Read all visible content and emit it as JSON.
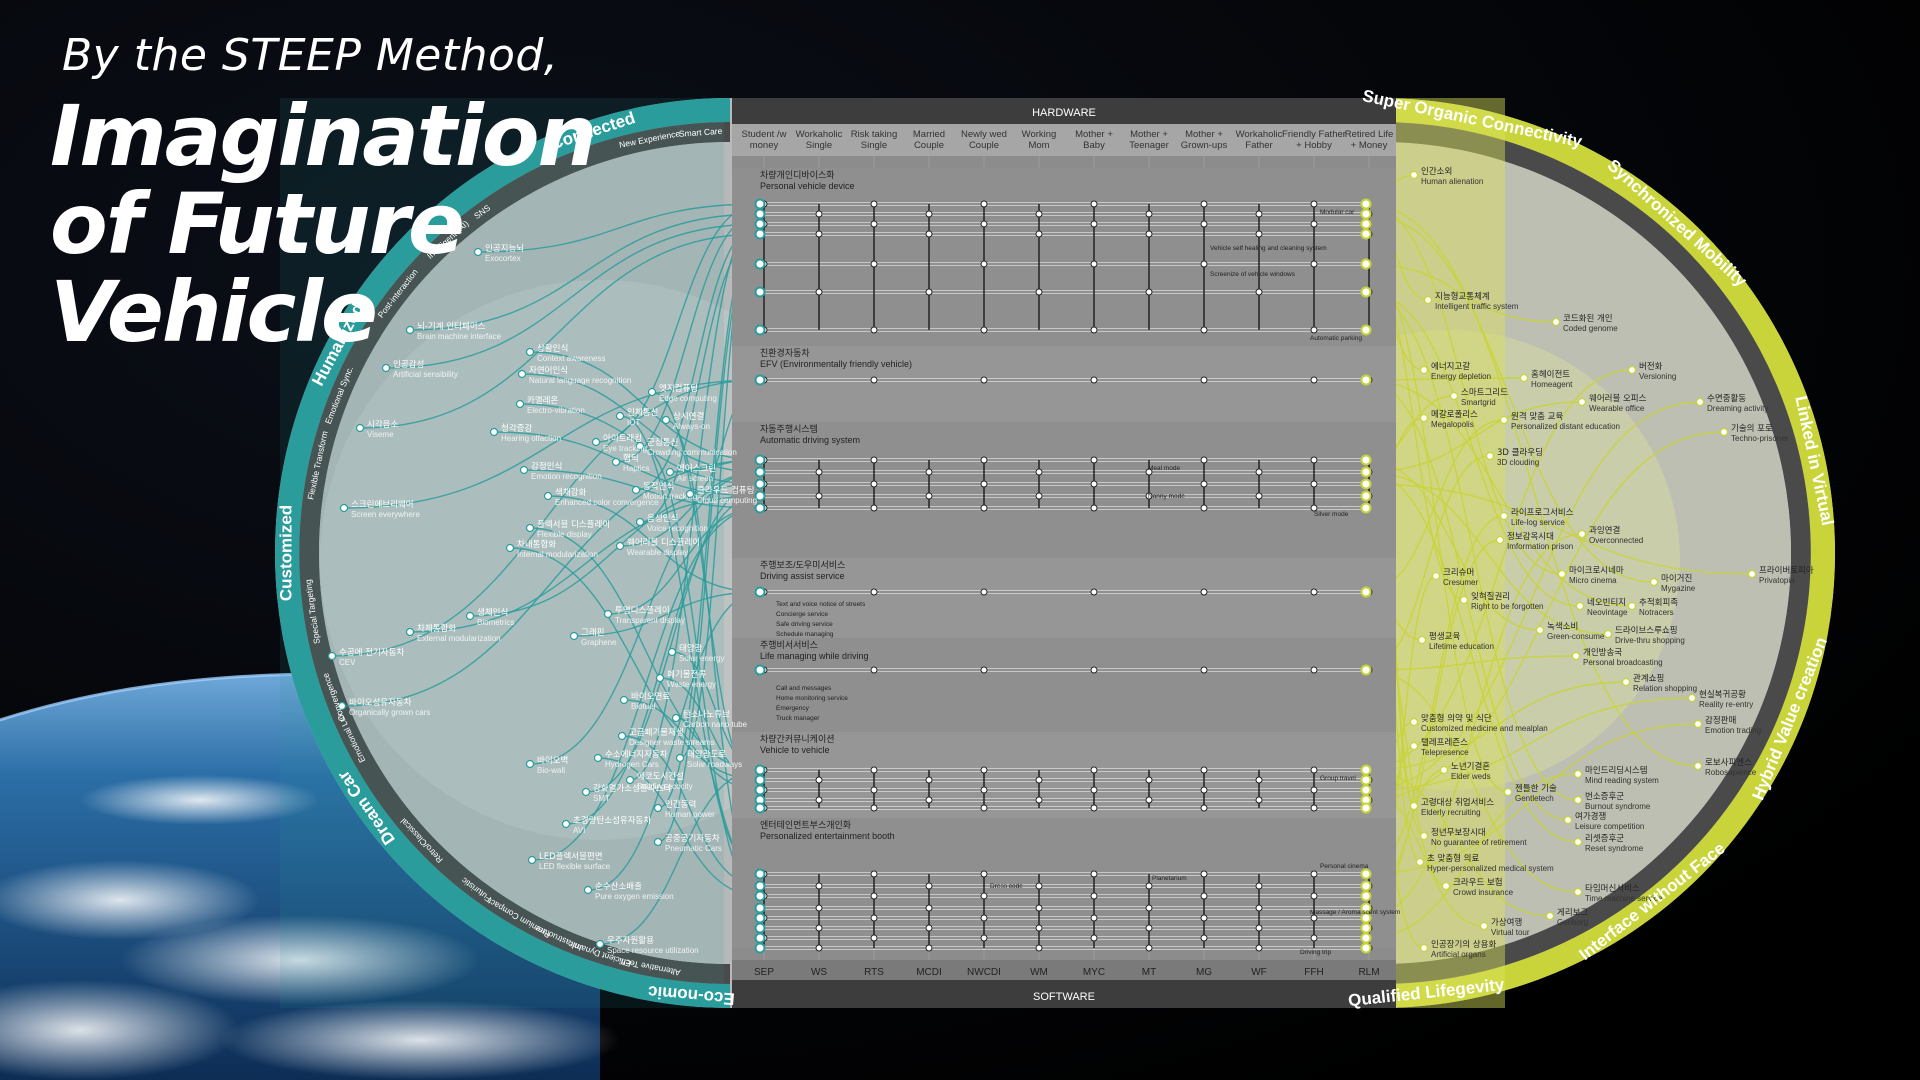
{
  "header": {
    "subtitle": "By the STEEP Method,",
    "title": "Imagination of Future Vehicle"
  },
  "colors": {
    "teal": "#2b9c9c",
    "lime": "#c9d43a",
    "panel": "#8c8c8c",
    "dark": "#3d3d3d"
  },
  "panel": {
    "top_label": "HARDWARE",
    "bottom_label": "SOFTWARE",
    "columns": [
      "Student /w money",
      "Workaholic Single",
      "Risk taking Single",
      "Married Couple",
      "Newly wed Couple",
      "Working Mom",
      "Mother + Baby",
      "Mother + Teenager",
      "Mother + Grown-ups",
      "Workaholic Father",
      "Friendly Father + Hobby",
      "Retired Life + Money"
    ],
    "column_codes": [
      "SEP",
      "WS",
      "RTS",
      "MCDI",
      "NWCDI",
      "WM",
      "MYC",
      "MT",
      "MG",
      "WF",
      "FFH",
      "RLM"
    ],
    "sections": [
      {
        "kr": "차량개인디바이스화",
        "en": "Personal vehicle device"
      },
      {
        "kr": "친환경자동차",
        "en": "EFV (Environmentally friendly vehicle)"
      },
      {
        "kr": "자동주행시스템",
        "en": "Automatic driving system"
      },
      {
        "kr": "주행보조/도우미서비스",
        "en": "Driving assist service"
      },
      {
        "kr": "주행비서서비스",
        "en": "Life managing while driving"
      },
      {
        "kr": "차량간커뮤니케이션",
        "en": "Vehicle to vehicle"
      },
      {
        "kr": "엔터테인먼트부스개인화",
        "en": "Personalized entertainment booth"
      }
    ],
    "notes": [
      "Modular car",
      "Vehicle self healing and cleaning system",
      "Screenize of vehicle windows",
      "Automatic parking",
      "Meal mode",
      "Nanny mode",
      "Silver mode",
      "Text and voice notice of streets",
      "Concierge service",
      "Safe driving service",
      "Schedule managing",
      "Call and messages",
      "Home monitoring service",
      "Emergency",
      "Truck manager",
      "Group travel",
      "Personal cinema",
      "Dress code",
      "Planetarium",
      "Massage / Aroma scent system",
      "Driving trip"
    ]
  },
  "left_ring": {
    "labels": [
      "Connected",
      "New Experience",
      "Smart Care",
      "SNS",
      "Intelligent (AI)",
      "Post-interaction",
      "Humanized",
      "Emotional Sync.",
      "Flexible Transform",
      "Customized",
      "Special Targeting",
      "Convergence",
      "Emotional Lux",
      "Dream Car",
      "Retro/Classical",
      "Futuristic",
      "Premium Compact",
      "Infrastructure",
      "Efficient Dynamic",
      "Alternative Tech.",
      "Eco-nomic"
    ]
  },
  "right_ring": {
    "labels": [
      "Super Organic Connectivity",
      "Synchronized Mobility",
      "Linked in Virtual",
      "Hybrid Value creation",
      "Interface without Face",
      "Qualified Lifegevity"
    ]
  },
  "left_nodes": [
    {
      "kr": "인공지능뇌",
      "en": "Exocortex"
    },
    {
      "kr": "뇌-기계 인터페이스",
      "en": "Brain machine interface"
    },
    {
      "kr": "인공감성",
      "en": "Artificial sensibility"
    },
    {
      "kr": "시각음소",
      "en": "Viseme"
    },
    {
      "kr": "스크린에브리웨어",
      "en": "Screen everywhere"
    },
    {
      "kr": "상황인식",
      "en": "Context awareness"
    },
    {
      "kr": "자연어인식",
      "en": "Natural language recognition"
    },
    {
      "kr": "카멜레온",
      "en": "Electro-vibration"
    },
    {
      "kr": "청각증강",
      "en": "Hearing olfaction"
    },
    {
      "kr": "감정인식",
      "en": "Emotion recognition"
    },
    {
      "kr": "색채강화",
      "en": "Enhanced color convergence"
    },
    {
      "kr": "플렉서블 디스플레이",
      "en": "Flexible display"
    },
    {
      "kr": "차내통합화",
      "en": "Internal modularization"
    },
    {
      "kr": "엣지컴퓨팅",
      "en": "Edge computing"
    },
    {
      "kr": "인체통신",
      "en": "IOT"
    },
    {
      "kr": "상시연결",
      "en": "Always-on"
    },
    {
      "kr": "군집통신",
      "en": "Crowding communication"
    },
    {
      "kr": "아이트래킹",
      "en": "Eye tracking"
    },
    {
      "kr": "햅틱",
      "en": "Haptics"
    },
    {
      "kr": "동작인식",
      "en": "Motion tracking"
    },
    {
      "kr": "음성인식",
      "en": "Voice recognition"
    },
    {
      "kr": "클라우드 컴퓨팅",
      "en": "Cloud computing"
    },
    {
      "kr": "에어스크린",
      "en": "Air screen"
    },
    {
      "kr": "웨어러블 디스플레이",
      "en": "Wearable display"
    },
    {
      "kr": "생체인식",
      "en": "Biometrics"
    },
    {
      "kr": "차체통합화",
      "en": "External modularization"
    },
    {
      "kr": "투명디스플레이",
      "en": "Transparent display"
    },
    {
      "kr": "그래핀",
      "en": "Graphene"
    },
    {
      "kr": "태양광",
      "en": "Solar energy"
    },
    {
      "kr": "폐기물전류",
      "en": "Waste energy"
    },
    {
      "kr": "바이오연료",
      "en": "Biofuel"
    },
    {
      "kr": "탄소나노튜브",
      "en": "Carbon nano tube"
    },
    {
      "kr": "고급폐기물재생",
      "en": "Designer waste streams"
    },
    {
      "kr": "수소에너지자동차",
      "en": "Hydrogen Cars"
    },
    {
      "kr": "태양광도로",
      "en": "Solar roadways"
    },
    {
      "kr": "에코도시건설",
      "en": "Building ecocity"
    },
    {
      "kr": "인간동력",
      "en": "Human power"
    },
    {
      "kr": "공중공기자동차",
      "en": "Pneumatic Cars"
    },
    {
      "kr": "수공에 전기자동차",
      "en": "CEV"
    },
    {
      "kr": "바이오성유자동차",
      "en": "Organically grown cars"
    },
    {
      "kr": "바이오벽",
      "en": "Bio-wall"
    },
    {
      "kr": "강화열가소성플라스틱",
      "en": "SMT"
    },
    {
      "kr": "초경량탄소섬유자동차",
      "en": "AVI"
    },
    {
      "kr": "LED플렉서블편면",
      "en": "LED flexible surface"
    },
    {
      "kr": "순수산소배출",
      "en": "Pure oxygen emission"
    },
    {
      "kr": "우주자원활용",
      "en": "Space resource utilization"
    }
  ],
  "right_nodes": [
    {
      "kr": "인간소외",
      "en": "Human alienation"
    },
    {
      "kr": "지능형교통체계",
      "en": "Intelligent traffic system"
    },
    {
      "kr": "코드화된 개인",
      "en": "Coded genome"
    },
    {
      "kr": "에너지고갈",
      "en": "Energy depletion"
    },
    {
      "kr": "홈헤이전트",
      "en": "Homeagent"
    },
    {
      "kr": "스마트그리드",
      "en": "Smartgrid"
    },
    {
      "kr": "웨어러블 오피스",
      "en": "Wearable office"
    },
    {
      "kr": "메갈로폴리스",
      "en": "Megalopolis"
    },
    {
      "kr": "원격 맞춤 교육",
      "en": "Personalized distant education"
    },
    {
      "kr": "3D 클라우딩",
      "en": "3D clouding"
    },
    {
      "kr": "버전화",
      "en": "Versioning"
    },
    {
      "kr": "수면중활동",
      "en": "Dreaming activity"
    },
    {
      "kr": "기술의 포로",
      "en": "Techno-prisoner"
    },
    {
      "kr": "라이프로그서비스",
      "en": "Life-log service"
    },
    {
      "kr": "정보감옥시대",
      "en": "Imformation prison"
    },
    {
      "kr": "과잉연결",
      "en": "Overconnected"
    },
    {
      "kr": "크리슈머",
      "en": "Cresumer"
    },
    {
      "kr": "마이크로시네마",
      "en": "Micro cinema"
    },
    {
      "kr": "마이거진",
      "en": "Mygazine"
    },
    {
      "kr": "잊혀질권리",
      "en": "Right to be forgotten"
    },
    {
      "kr": "네오빈티지",
      "en": "Neovintage"
    },
    {
      "kr": "추적회피족",
      "en": "Notracers"
    },
    {
      "kr": "녹색소비",
      "en": "Green-consume"
    },
    {
      "kr": "드라이브스루쇼핑",
      "en": "Drive-thru shopping"
    },
    {
      "kr": "프라이버토피아",
      "en": "Privatopia"
    },
    {
      "kr": "평생교육",
      "en": "Lifetime education"
    },
    {
      "kr": "개인방송국",
      "en": "Personal broadcasting"
    },
    {
      "kr": "관계쇼핑",
      "en": "Relation shopping"
    },
    {
      "kr": "현실복귀공황",
      "en": "Reality re-entry"
    },
    {
      "kr": "맞춤형 의약 및 식단",
      "en": "Customized medicine and mealplan"
    },
    {
      "kr": "감정판매",
      "en": "Emotion trading"
    },
    {
      "kr": "텔레프레즌스",
      "en": "Telepresence"
    },
    {
      "kr": "노년기결혼",
      "en": "Elder weds"
    },
    {
      "kr": "마인드리딩시스템",
      "en": "Mind reading system"
    },
    {
      "kr": "로보사피엔스",
      "en": "Robosapience"
    },
    {
      "kr": "고령대상 취업서비스",
      "en": "Elderly recruiting"
    },
    {
      "kr": "젠틀한 기술",
      "en": "Gentletech"
    },
    {
      "kr": "번소증후군",
      "en": "Burnout syndrome"
    },
    {
      "kr": "여가경쟁",
      "en": "Leisure competition"
    },
    {
      "kr": "정년무보장시대",
      "en": "No guarantee of retirement"
    },
    {
      "kr": "리셋증후군",
      "en": "Reset syndrome"
    },
    {
      "kr": "초 맞춤형 의료",
      "en": "Hyper-personalized medical system"
    },
    {
      "kr": "크라우드 보험",
      "en": "Crowd insurance"
    },
    {
      "kr": "타임머신서비스",
      "en": "Time machine service"
    },
    {
      "kr": "게리보그",
      "en": "Geriborg"
    },
    {
      "kr": "가상여행",
      "en": "Virtual tour"
    },
    {
      "kr": "인공장기의 상용화",
      "en": "Artificial organs"
    }
  ]
}
